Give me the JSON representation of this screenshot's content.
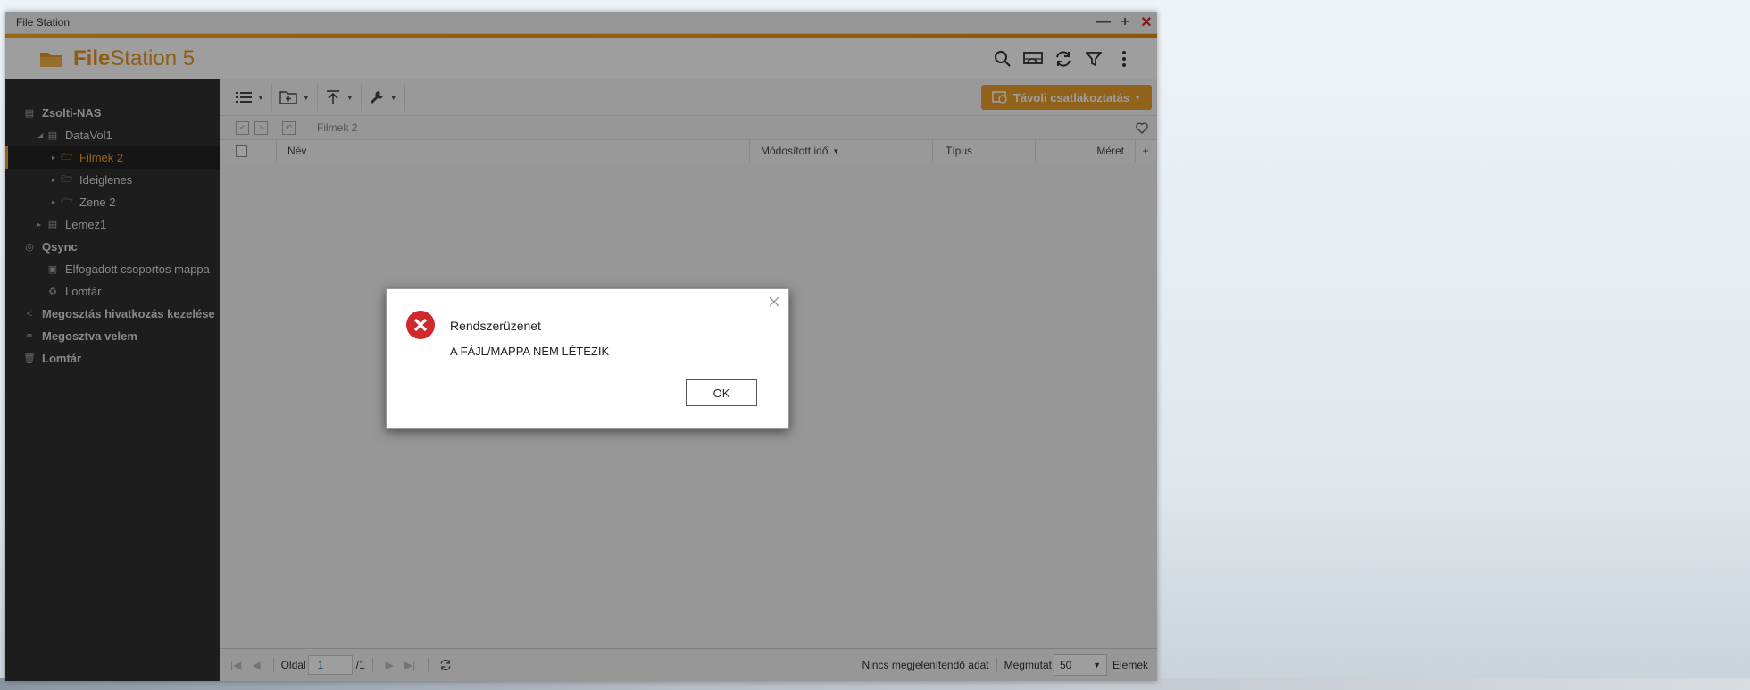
{
  "window": {
    "title": "File Station"
  },
  "app": {
    "logo_bold": "File",
    "logo_regular": "Station 5"
  },
  "sidebar": {
    "items": [
      {
        "label": "Zsolti-NAS"
      },
      {
        "label": "DataVol1"
      },
      {
        "label": "Filmek 2"
      },
      {
        "label": "Ideiglenes"
      },
      {
        "label": "Zene 2"
      },
      {
        "label": "Lemez1"
      },
      {
        "label": "Qsync"
      },
      {
        "label": "Elfogadott csoportos mappa"
      },
      {
        "label": "Lomtár"
      },
      {
        "label": "Megosztás hivatkozás kezelése"
      },
      {
        "label": "Megosztva velem"
      },
      {
        "label": "Lomtár"
      }
    ]
  },
  "toolbar": {
    "remote_mount": "Távoli csatlakoztatás"
  },
  "pathbar": {
    "path": "Filmek 2"
  },
  "table": {
    "columns": {
      "name": "Név",
      "modified": "Módosított idő",
      "type": "Típus",
      "size": "Méret"
    }
  },
  "statusbar": {
    "page_label": "Oldal",
    "page_value": "1",
    "page_total": "/1",
    "no_data": "Nincs megjelenítendő adat",
    "show_label": "Megmutat",
    "show_value": "50",
    "items_label": "Elemek"
  },
  "dialog": {
    "title": "Rendszerüzenet",
    "message": "A FÁJL/MAPPA NEM LÉTEZIK",
    "ok": "OK"
  },
  "colors": {
    "accent": "#e8951c",
    "sidebar_bg": "#2f2f2f",
    "error": "#d0282c"
  }
}
